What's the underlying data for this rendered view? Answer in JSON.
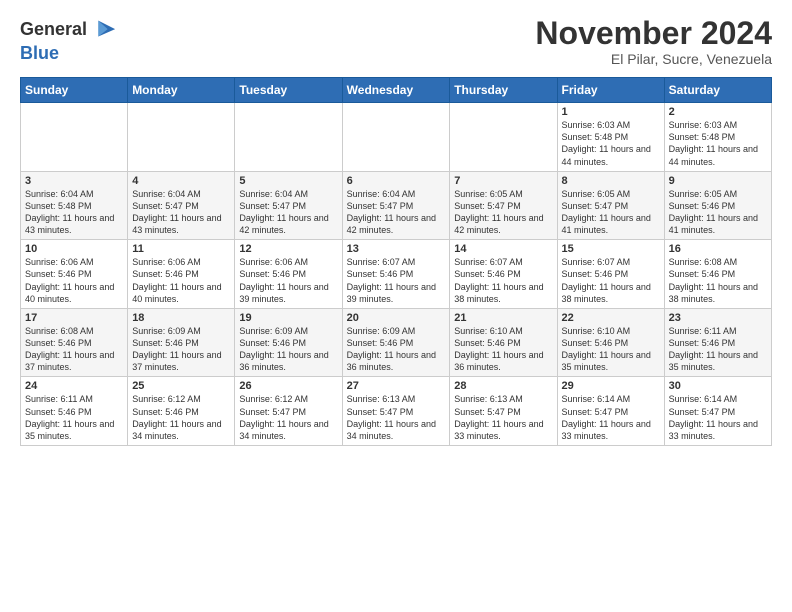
{
  "header": {
    "logo_general": "General",
    "logo_blue": "Blue",
    "month_title": "November 2024",
    "location": "El Pilar, Sucre, Venezuela"
  },
  "weekdays": [
    "Sunday",
    "Monday",
    "Tuesday",
    "Wednesday",
    "Thursday",
    "Friday",
    "Saturday"
  ],
  "weeks": [
    [
      {
        "day": "",
        "info": ""
      },
      {
        "day": "",
        "info": ""
      },
      {
        "day": "",
        "info": ""
      },
      {
        "day": "",
        "info": ""
      },
      {
        "day": "",
        "info": ""
      },
      {
        "day": "1",
        "info": "Sunrise: 6:03 AM\nSunset: 5:48 PM\nDaylight: 11 hours\nand 44 minutes."
      },
      {
        "day": "2",
        "info": "Sunrise: 6:03 AM\nSunset: 5:48 PM\nDaylight: 11 hours\nand 44 minutes."
      }
    ],
    [
      {
        "day": "3",
        "info": "Sunrise: 6:04 AM\nSunset: 5:48 PM\nDaylight: 11 hours\nand 43 minutes."
      },
      {
        "day": "4",
        "info": "Sunrise: 6:04 AM\nSunset: 5:47 PM\nDaylight: 11 hours\nand 43 minutes."
      },
      {
        "day": "5",
        "info": "Sunrise: 6:04 AM\nSunset: 5:47 PM\nDaylight: 11 hours\nand 42 minutes."
      },
      {
        "day": "6",
        "info": "Sunrise: 6:04 AM\nSunset: 5:47 PM\nDaylight: 11 hours\nand 42 minutes."
      },
      {
        "day": "7",
        "info": "Sunrise: 6:05 AM\nSunset: 5:47 PM\nDaylight: 11 hours\nand 42 minutes."
      },
      {
        "day": "8",
        "info": "Sunrise: 6:05 AM\nSunset: 5:47 PM\nDaylight: 11 hours\nand 41 minutes."
      },
      {
        "day": "9",
        "info": "Sunrise: 6:05 AM\nSunset: 5:46 PM\nDaylight: 11 hours\nand 41 minutes."
      }
    ],
    [
      {
        "day": "10",
        "info": "Sunrise: 6:06 AM\nSunset: 5:46 PM\nDaylight: 11 hours\nand 40 minutes."
      },
      {
        "day": "11",
        "info": "Sunrise: 6:06 AM\nSunset: 5:46 PM\nDaylight: 11 hours\nand 40 minutes."
      },
      {
        "day": "12",
        "info": "Sunrise: 6:06 AM\nSunset: 5:46 PM\nDaylight: 11 hours\nand 39 minutes."
      },
      {
        "day": "13",
        "info": "Sunrise: 6:07 AM\nSunset: 5:46 PM\nDaylight: 11 hours\nand 39 minutes."
      },
      {
        "day": "14",
        "info": "Sunrise: 6:07 AM\nSunset: 5:46 PM\nDaylight: 11 hours\nand 38 minutes."
      },
      {
        "day": "15",
        "info": "Sunrise: 6:07 AM\nSunset: 5:46 PM\nDaylight: 11 hours\nand 38 minutes."
      },
      {
        "day": "16",
        "info": "Sunrise: 6:08 AM\nSunset: 5:46 PM\nDaylight: 11 hours\nand 38 minutes."
      }
    ],
    [
      {
        "day": "17",
        "info": "Sunrise: 6:08 AM\nSunset: 5:46 PM\nDaylight: 11 hours\nand 37 minutes."
      },
      {
        "day": "18",
        "info": "Sunrise: 6:09 AM\nSunset: 5:46 PM\nDaylight: 11 hours\nand 37 minutes."
      },
      {
        "day": "19",
        "info": "Sunrise: 6:09 AM\nSunset: 5:46 PM\nDaylight: 11 hours\nand 36 minutes."
      },
      {
        "day": "20",
        "info": "Sunrise: 6:09 AM\nSunset: 5:46 PM\nDaylight: 11 hours\nand 36 minutes."
      },
      {
        "day": "21",
        "info": "Sunrise: 6:10 AM\nSunset: 5:46 PM\nDaylight: 11 hours\nand 36 minutes."
      },
      {
        "day": "22",
        "info": "Sunrise: 6:10 AM\nSunset: 5:46 PM\nDaylight: 11 hours\nand 35 minutes."
      },
      {
        "day": "23",
        "info": "Sunrise: 6:11 AM\nSunset: 5:46 PM\nDaylight: 11 hours\nand 35 minutes."
      }
    ],
    [
      {
        "day": "24",
        "info": "Sunrise: 6:11 AM\nSunset: 5:46 PM\nDaylight: 11 hours\nand 35 minutes."
      },
      {
        "day": "25",
        "info": "Sunrise: 6:12 AM\nSunset: 5:46 PM\nDaylight: 11 hours\nand 34 minutes."
      },
      {
        "day": "26",
        "info": "Sunrise: 6:12 AM\nSunset: 5:47 PM\nDaylight: 11 hours\nand 34 minutes."
      },
      {
        "day": "27",
        "info": "Sunrise: 6:13 AM\nSunset: 5:47 PM\nDaylight: 11 hours\nand 34 minutes."
      },
      {
        "day": "28",
        "info": "Sunrise: 6:13 AM\nSunset: 5:47 PM\nDaylight: 11 hours\nand 33 minutes."
      },
      {
        "day": "29",
        "info": "Sunrise: 6:14 AM\nSunset: 5:47 PM\nDaylight: 11 hours\nand 33 minutes."
      },
      {
        "day": "30",
        "info": "Sunrise: 6:14 AM\nSunset: 5:47 PM\nDaylight: 11 hours\nand 33 minutes."
      }
    ]
  ]
}
